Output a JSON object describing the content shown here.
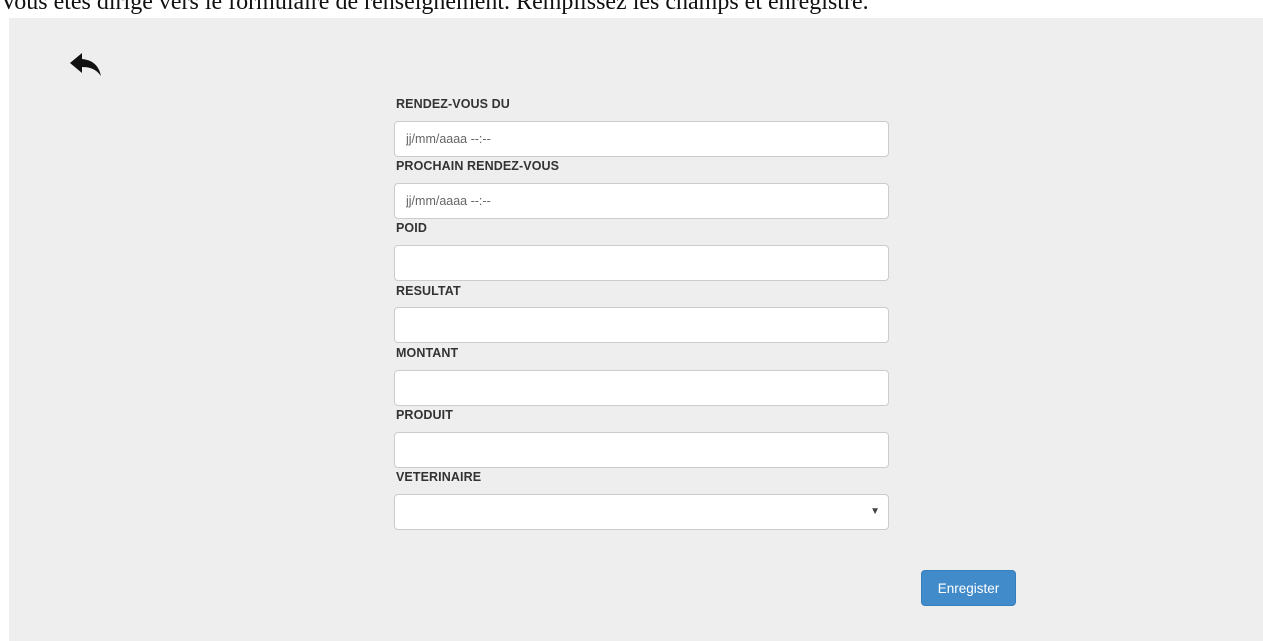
{
  "banner_text": "Vous êtes dirigé vers le formulaire de renseignement. Remplissez les champs et enregistré.",
  "back_icon": "reply-arrow-icon",
  "form": {
    "rendezvous_du": {
      "label": "RENDEZ-VOUS DU",
      "placeholder": "jj/mm/aaaa --:--",
      "value": ""
    },
    "prochain_rendezvous": {
      "label": "PROCHAIN RENDEZ-VOUS",
      "placeholder": "jj/mm/aaaa --:--",
      "value": ""
    },
    "poid": {
      "label": "POID",
      "value": ""
    },
    "resultat": {
      "label": "RESULTAT",
      "value": ""
    },
    "montant": {
      "label": "MONTANT",
      "value": ""
    },
    "produit": {
      "label": "PRODUIT",
      "value": ""
    },
    "veterinaire": {
      "label": "VETERINAIRE",
      "selected": "",
      "caret": "▼"
    }
  },
  "submit_label": "Enregister",
  "colors": {
    "panel_bg": "#eeeeee",
    "button_primary": "#428bca"
  }
}
